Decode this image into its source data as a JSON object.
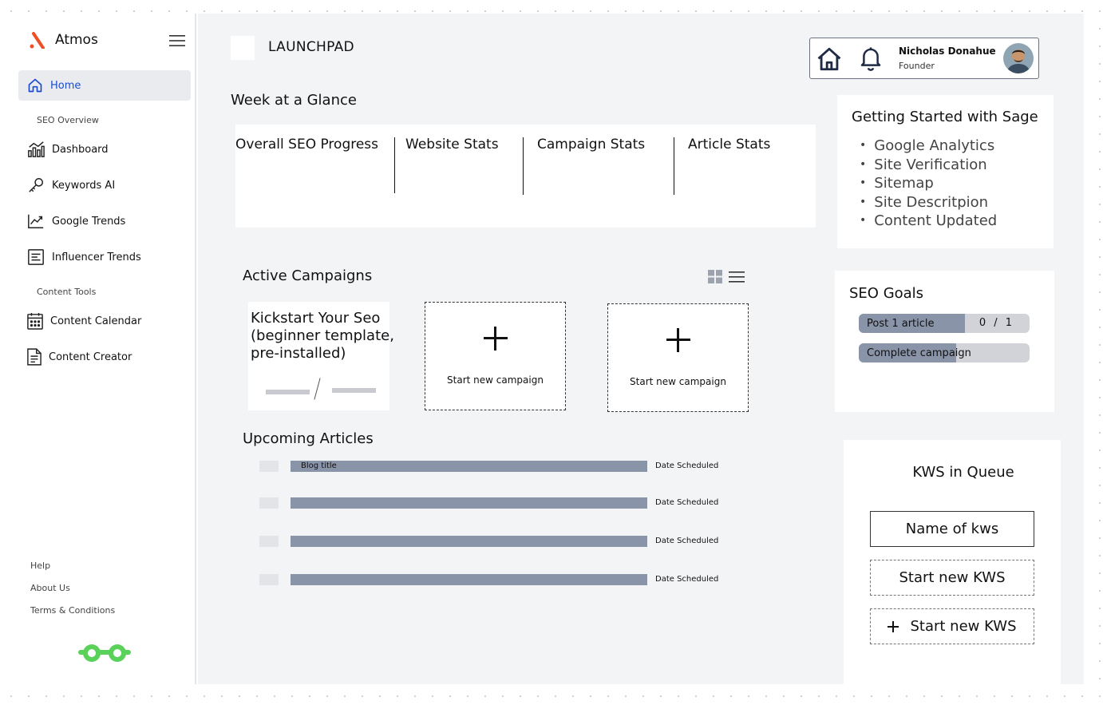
{
  "app": {
    "brand": "Atmos",
    "accent": "#1a4ccf",
    "logo_color": "#f04e23"
  },
  "sidebar": {
    "home": "Home",
    "section_seo": "SEO Overview",
    "seo_items": [
      "Dashboard",
      "Keywords AI",
      "Google Trends",
      "Influencer Trends"
    ],
    "section_content": "Content Tools",
    "content_items": [
      "Content Calendar",
      "Content Creator"
    ],
    "footer_links": [
      "Help",
      "About Us",
      "Terms & Conditions"
    ]
  },
  "header": {
    "title": "LAUNCHPAD",
    "user": {
      "name": "Nicholas Donahue",
      "role": "Founder"
    }
  },
  "week_at_glance": {
    "title": "Week at a Glance",
    "stats": [
      "Overall SEO Progress",
      "Website Stats",
      "Campaign Stats",
      "Article Stats"
    ]
  },
  "getting_started": {
    "title": "Getting Started with Sage",
    "items": [
      "Google Analytics",
      "Site Verification",
      "Sitemap",
      "Site Descritpion",
      "Content Updated"
    ]
  },
  "seo_goals": {
    "title": "SEO Goals",
    "goals": [
      {
        "label": "Post 1 article",
        "count": "0 / 1",
        "progress": 0.62
      },
      {
        "label": "Complete campaign",
        "progress": 0.57
      }
    ]
  },
  "active_campaigns": {
    "title": "Active Campaigns",
    "campaign_title": "Kickstart Your Seo (beginner template, pre-installed)",
    "new_labels": [
      "Start new campaign",
      "Start new campaign"
    ]
  },
  "upcoming_articles": {
    "title": "Upcoming Articles",
    "rows": [
      {
        "title": "Blog title",
        "date": "Date Scheduled"
      },
      {
        "title": "",
        "date": "Date Scheduled"
      },
      {
        "title": "",
        "date": "Date Scheduled"
      },
      {
        "title": "",
        "date": "Date Scheduled"
      }
    ]
  },
  "kws_queue": {
    "title": "KWS in Queue",
    "name_box": "Name of kws",
    "start_label": "Start new KWS",
    "start_label_2": "Start new KWS"
  }
}
